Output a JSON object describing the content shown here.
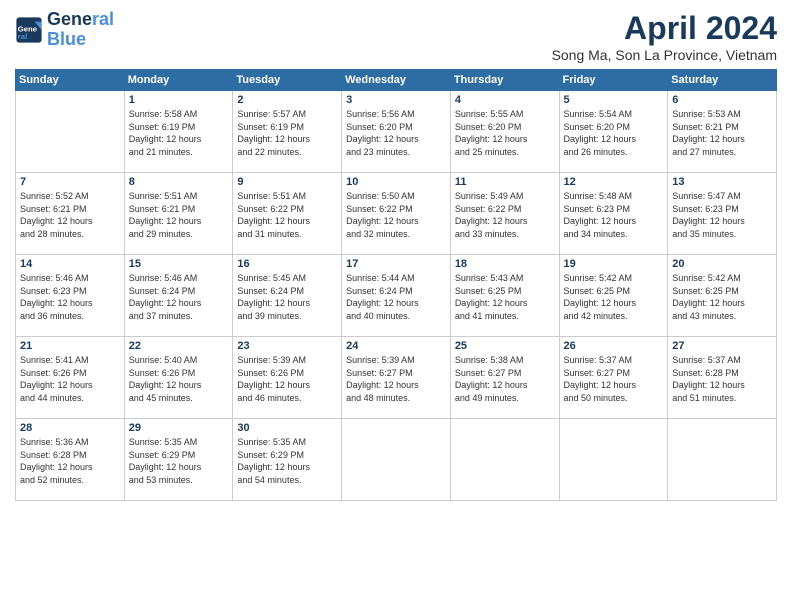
{
  "header": {
    "logo_line1": "General",
    "logo_line2": "Blue",
    "title": "April 2024",
    "location": "Song Ma, Son La Province, Vietnam"
  },
  "days_of_week": [
    "Sunday",
    "Monday",
    "Tuesday",
    "Wednesday",
    "Thursday",
    "Friday",
    "Saturday"
  ],
  "weeks": [
    [
      {
        "day": "",
        "info": ""
      },
      {
        "day": "1",
        "info": "Sunrise: 5:58 AM\nSunset: 6:19 PM\nDaylight: 12 hours\nand 21 minutes."
      },
      {
        "day": "2",
        "info": "Sunrise: 5:57 AM\nSunset: 6:19 PM\nDaylight: 12 hours\nand 22 minutes."
      },
      {
        "day": "3",
        "info": "Sunrise: 5:56 AM\nSunset: 6:20 PM\nDaylight: 12 hours\nand 23 minutes."
      },
      {
        "day": "4",
        "info": "Sunrise: 5:55 AM\nSunset: 6:20 PM\nDaylight: 12 hours\nand 25 minutes."
      },
      {
        "day": "5",
        "info": "Sunrise: 5:54 AM\nSunset: 6:20 PM\nDaylight: 12 hours\nand 26 minutes."
      },
      {
        "day": "6",
        "info": "Sunrise: 5:53 AM\nSunset: 6:21 PM\nDaylight: 12 hours\nand 27 minutes."
      }
    ],
    [
      {
        "day": "7",
        "info": "Sunrise: 5:52 AM\nSunset: 6:21 PM\nDaylight: 12 hours\nand 28 minutes."
      },
      {
        "day": "8",
        "info": "Sunrise: 5:51 AM\nSunset: 6:21 PM\nDaylight: 12 hours\nand 29 minutes."
      },
      {
        "day": "9",
        "info": "Sunrise: 5:51 AM\nSunset: 6:22 PM\nDaylight: 12 hours\nand 31 minutes."
      },
      {
        "day": "10",
        "info": "Sunrise: 5:50 AM\nSunset: 6:22 PM\nDaylight: 12 hours\nand 32 minutes."
      },
      {
        "day": "11",
        "info": "Sunrise: 5:49 AM\nSunset: 6:22 PM\nDaylight: 12 hours\nand 33 minutes."
      },
      {
        "day": "12",
        "info": "Sunrise: 5:48 AM\nSunset: 6:23 PM\nDaylight: 12 hours\nand 34 minutes."
      },
      {
        "day": "13",
        "info": "Sunrise: 5:47 AM\nSunset: 6:23 PM\nDaylight: 12 hours\nand 35 minutes."
      }
    ],
    [
      {
        "day": "14",
        "info": "Sunrise: 5:46 AM\nSunset: 6:23 PM\nDaylight: 12 hours\nand 36 minutes."
      },
      {
        "day": "15",
        "info": "Sunrise: 5:46 AM\nSunset: 6:24 PM\nDaylight: 12 hours\nand 37 minutes."
      },
      {
        "day": "16",
        "info": "Sunrise: 5:45 AM\nSunset: 6:24 PM\nDaylight: 12 hours\nand 39 minutes."
      },
      {
        "day": "17",
        "info": "Sunrise: 5:44 AM\nSunset: 6:24 PM\nDaylight: 12 hours\nand 40 minutes."
      },
      {
        "day": "18",
        "info": "Sunrise: 5:43 AM\nSunset: 6:25 PM\nDaylight: 12 hours\nand 41 minutes."
      },
      {
        "day": "19",
        "info": "Sunrise: 5:42 AM\nSunset: 6:25 PM\nDaylight: 12 hours\nand 42 minutes."
      },
      {
        "day": "20",
        "info": "Sunrise: 5:42 AM\nSunset: 6:25 PM\nDaylight: 12 hours\nand 43 minutes."
      }
    ],
    [
      {
        "day": "21",
        "info": "Sunrise: 5:41 AM\nSunset: 6:26 PM\nDaylight: 12 hours\nand 44 minutes."
      },
      {
        "day": "22",
        "info": "Sunrise: 5:40 AM\nSunset: 6:26 PM\nDaylight: 12 hours\nand 45 minutes."
      },
      {
        "day": "23",
        "info": "Sunrise: 5:39 AM\nSunset: 6:26 PM\nDaylight: 12 hours\nand 46 minutes."
      },
      {
        "day": "24",
        "info": "Sunrise: 5:39 AM\nSunset: 6:27 PM\nDaylight: 12 hours\nand 48 minutes."
      },
      {
        "day": "25",
        "info": "Sunrise: 5:38 AM\nSunset: 6:27 PM\nDaylight: 12 hours\nand 49 minutes."
      },
      {
        "day": "26",
        "info": "Sunrise: 5:37 AM\nSunset: 6:27 PM\nDaylight: 12 hours\nand 50 minutes."
      },
      {
        "day": "27",
        "info": "Sunrise: 5:37 AM\nSunset: 6:28 PM\nDaylight: 12 hours\nand 51 minutes."
      }
    ],
    [
      {
        "day": "28",
        "info": "Sunrise: 5:36 AM\nSunset: 6:28 PM\nDaylight: 12 hours\nand 52 minutes."
      },
      {
        "day": "29",
        "info": "Sunrise: 5:35 AM\nSunset: 6:29 PM\nDaylight: 12 hours\nand 53 minutes."
      },
      {
        "day": "30",
        "info": "Sunrise: 5:35 AM\nSunset: 6:29 PM\nDaylight: 12 hours\nand 54 minutes."
      },
      {
        "day": "",
        "info": ""
      },
      {
        "day": "",
        "info": ""
      },
      {
        "day": "",
        "info": ""
      },
      {
        "day": "",
        "info": ""
      }
    ]
  ]
}
